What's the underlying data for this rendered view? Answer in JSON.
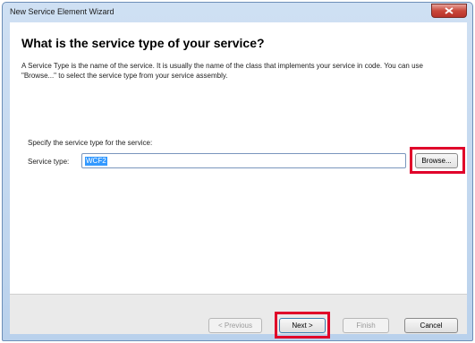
{
  "window": {
    "title": "New Service Element Wizard"
  },
  "header": {
    "heading": "What is the service type of your service?",
    "description": "A Service Type is the name of the service. It is usually the name of the class that implements your service in code. You can use \"Browse...\" to select the service type from your service assembly."
  },
  "form": {
    "prompt": "Specify the service type for the service:",
    "service_type_label": "Service type:",
    "service_type_value": "WCF2",
    "browse_label": "Browse..."
  },
  "footer": {
    "previous_label": "< Previous",
    "next_label": "Next >",
    "finish_label": "Finish",
    "cancel_label": "Cancel"
  },
  "colors": {
    "highlight_box": "#e0002a",
    "selection": "#3399ff"
  }
}
